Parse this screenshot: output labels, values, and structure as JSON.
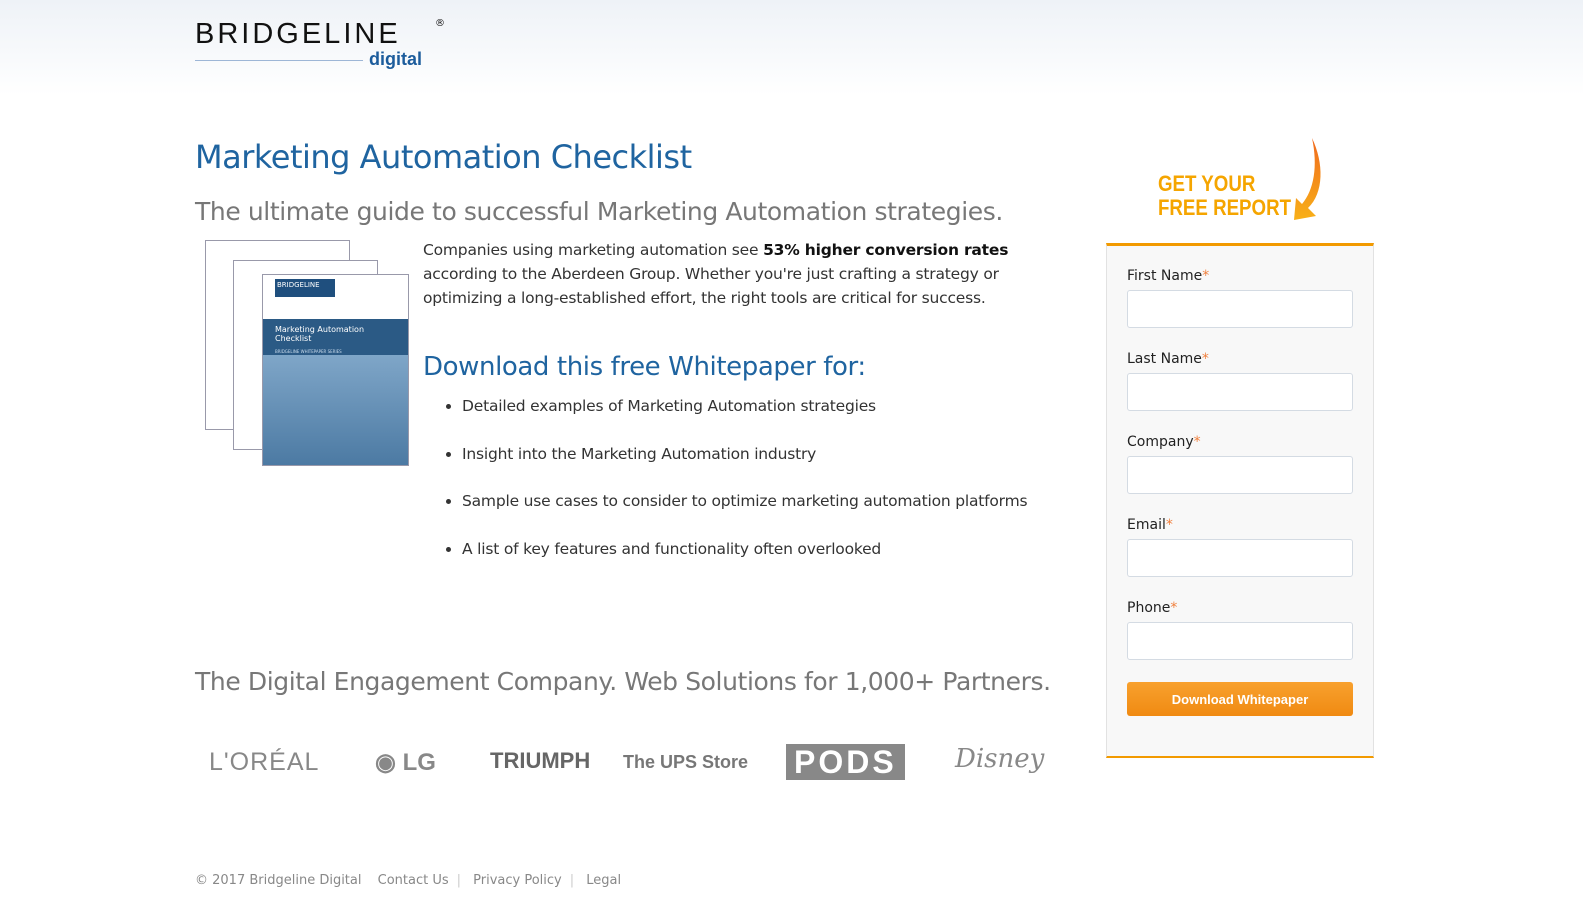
{
  "brand": {
    "name": "BRIDGELINE",
    "sub": "digital",
    "mark": "®"
  },
  "main": {
    "title": "Marketing Automation Checklist",
    "subtitle": "The ultimate guide to successful Marketing Automation strategies.",
    "intro_pre": "Companies using marketing automation see ",
    "intro_bold": "53% higher conversion rates",
    "intro_post": " according to the Aberdeen Group. Whether you're just crafting a strategy or optimizing a long-established effort, the right tools are critical for success.",
    "download_heading": "Download this free Whitepaper for:",
    "bullets": [
      "Detailed examples of Marketing Automation strategies",
      "Insight into the Marketing Automation industry",
      "Sample use cases to consider to optimize marketing automation platforms",
      "A list of key features and functionality often overlooked"
    ],
    "cover": {
      "brand": "BRIDGELINE",
      "title": "Marketing Automation Checklist",
      "series": "BRIDGELINE WHITEPAPER SERIES"
    }
  },
  "tagline": "The Digital Engagement Company. Web Solutions for 1,000+ Partners.",
  "partners": [
    "L'ORÉAL",
    "LG",
    "TRIUMPH",
    "The UPS Store",
    "PODS",
    "Disney"
  ],
  "cta": {
    "line1": "GET YOUR",
    "line2": "FREE REPORT"
  },
  "form": {
    "fields": [
      {
        "label": "First Name",
        "value": ""
      },
      {
        "label": "Last Name",
        "value": ""
      },
      {
        "label": "Company",
        "value": ""
      },
      {
        "label": "Email",
        "value": ""
      },
      {
        "label": "Phone",
        "value": ""
      }
    ],
    "required_mark": "*",
    "submit": "Download Whitepaper"
  },
  "footer": {
    "copyright": "© 2017 Bridgeline Digital",
    "links": [
      "Contact Us",
      "Privacy Policy",
      "Legal"
    ]
  },
  "colors": {
    "accent": "#1f64a0",
    "orange": "#f29a00"
  }
}
